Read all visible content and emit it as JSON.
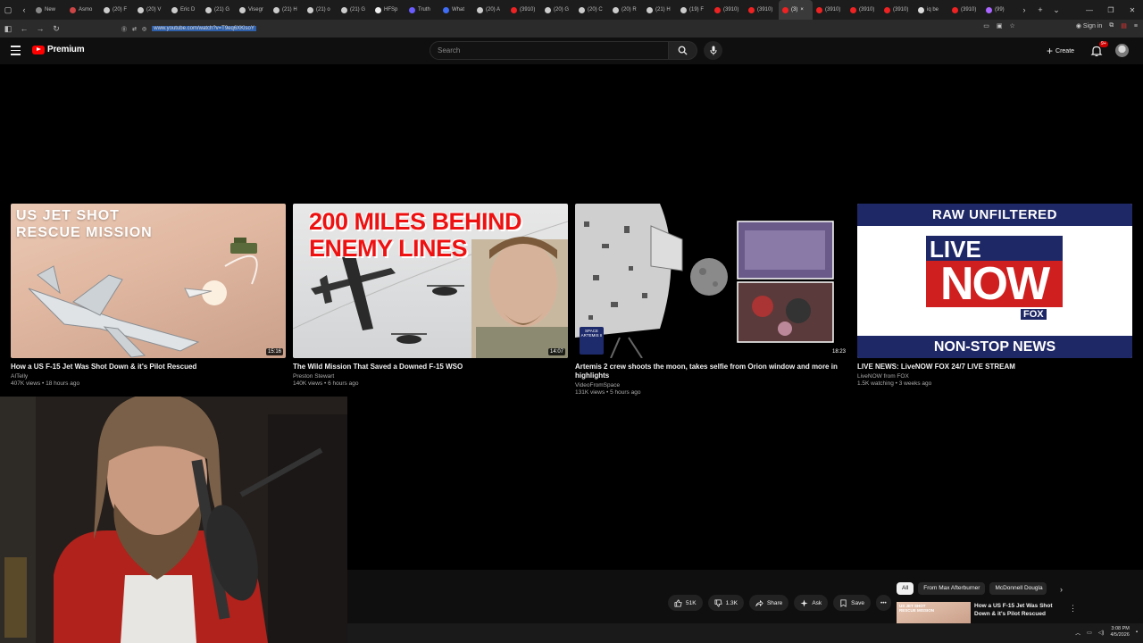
{
  "browser": {
    "tabs": [
      {
        "label": "New",
        "color": "#888888"
      },
      {
        "label": "Asmo",
        "color": "#c44"
      },
      {
        "label": "(20) F",
        "color": "#ccc"
      },
      {
        "label": "(20) V",
        "color": "#ccc"
      },
      {
        "label": "Eric D",
        "color": "#ccc"
      },
      {
        "label": "(21) G",
        "color": "#ccc"
      },
      {
        "label": "Visegr",
        "color": "#ccc"
      },
      {
        "label": "(21) H",
        "color": "#ccc"
      },
      {
        "label": "(21) o",
        "color": "#ccc"
      },
      {
        "label": "(21) G",
        "color": "#ccc"
      },
      {
        "label": "HFSp",
        "color": "#eee"
      },
      {
        "label": "Truth",
        "color": "#6a5cff"
      },
      {
        "label": "What",
        "color": "#3f6df5"
      },
      {
        "label": "(20) A",
        "color": "#ccc"
      },
      {
        "label": "(3910)",
        "color": "#e22"
      },
      {
        "label": "(20) G",
        "color": "#ccc"
      },
      {
        "label": "(20) C",
        "color": "#ccc"
      },
      {
        "label": "(20) R",
        "color": "#ccc"
      },
      {
        "label": "(21) H",
        "color": "#ccc"
      },
      {
        "label": "(19) F",
        "color": "#ccc"
      },
      {
        "label": "(3910)",
        "color": "#e22"
      },
      {
        "label": "(3910)",
        "color": "#e22"
      },
      {
        "label": "(3)",
        "color": "#e22",
        "active": true
      },
      {
        "label": "(3910)",
        "color": "#e22"
      },
      {
        "label": "(3910)",
        "color": "#e22"
      },
      {
        "label": "(3910)",
        "color": "#e22"
      },
      {
        "label": "iq be",
        "color": "#ddd"
      },
      {
        "label": "(3910)",
        "color": "#e22"
      },
      {
        "label": "(99)",
        "color": "#a6f"
      }
    ],
    "url": "www.youtube.com/watch?v=T9eq6XKlsoY",
    "signin": "Sign in"
  },
  "youtube": {
    "logo": "Premium",
    "search_placeholder": "Search",
    "create_label": "Create",
    "notif_badge": "9+"
  },
  "videos": [
    {
      "thumb_text": "US JET SHOT\nRESCUE MISSION",
      "duration": "15:16",
      "title": "How a US F-15 Jet Was Shot Down & it's Pilot Rescued",
      "channel": "AITelly",
      "meta": "407K views • 18 hours ago"
    },
    {
      "thumb_text": "200 MILES BEHIND\nENEMY LINES",
      "duration": "14:07",
      "title": "The Wild Mission That Saved a Downed F-15 WSO",
      "channel": "Preston Stewart",
      "meta": "140K views • 6 hours ago"
    },
    {
      "thumb_badge": "SPACE\nARTEMIS II",
      "duration": "18:23",
      "title": "Artemis 2 crew shoots the moon, takes selfie from Orion window and more in highlights",
      "channel": "VideoFromSpace",
      "meta": "131K views • 5 hours ago"
    },
    {
      "thumb_top": "RAW  UNFILTERED",
      "thumb_live": "LIVE",
      "thumb_now": "NOW",
      "thumb_fox": "FOX",
      "thumb_bottom": "NON-STOP NEWS",
      "title": "LIVE NEWS: LiveNOW FOX 24/7 LIVE STREAM",
      "channel": "LiveNOW from FOX",
      "meta": "1.5K watching • 3 weeks ago"
    }
  ],
  "player": {
    "likes": "51K",
    "dislikes": "1.3K",
    "share": "Share",
    "ask": "Ask",
    "save": "Save",
    "chips": [
      "All",
      "From Max Afterburner",
      "McDonnell Dougla"
    ],
    "rec_title": "How a US F-15 Jet Was Shot Down & it's Pilot Rescued",
    "rec_thumb_text": "US JET SHOT\nRESCUE MISSION"
  },
  "taskbar": {
    "time": "3:08 PM",
    "date": "4/5/2026"
  }
}
